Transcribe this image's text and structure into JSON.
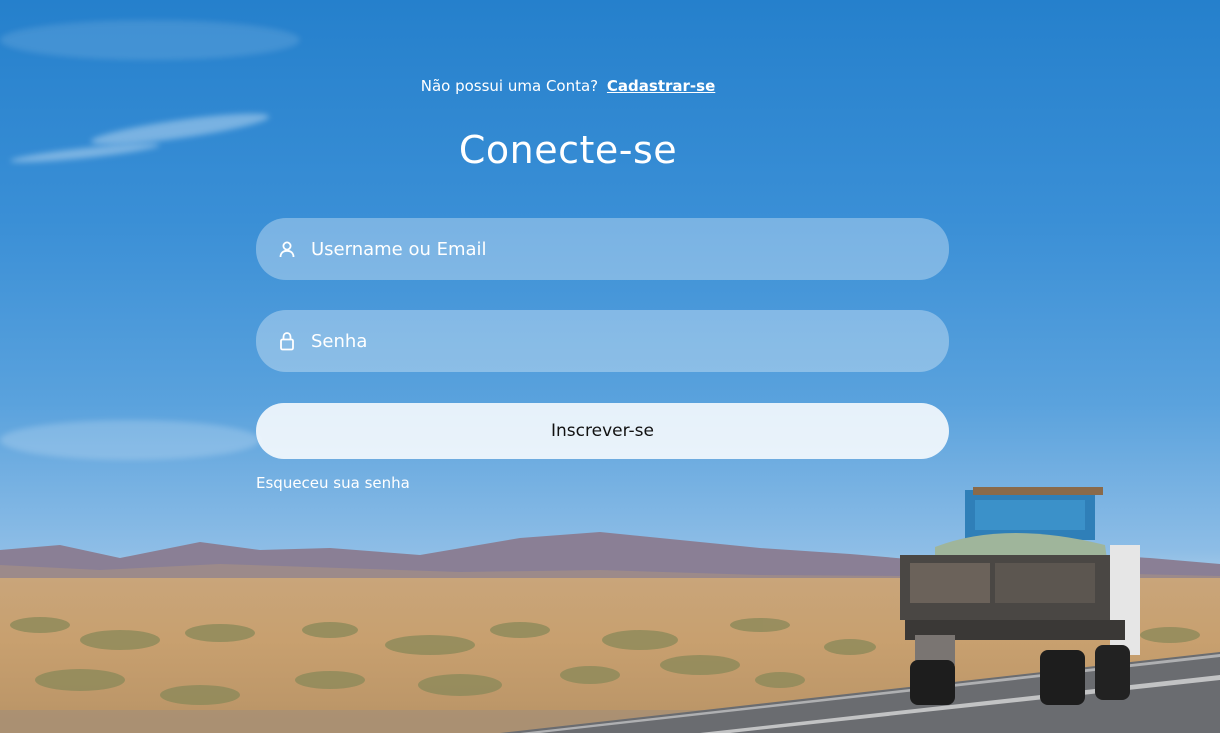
{
  "signup": {
    "prompt": "Não possui uma Conta?",
    "link_label": "Cadastrar-se"
  },
  "login": {
    "title": "Conecte-se",
    "username_placeholder": "Username ou Email",
    "password_placeholder": "Senha",
    "submit_label": "Inscrever-se",
    "forgot_label": "Esqueceu sua senha"
  },
  "icons": {
    "username": "user-icon",
    "password": "lock-icon"
  },
  "colors": {
    "text": "#ffffff",
    "button_text": "#111111"
  }
}
